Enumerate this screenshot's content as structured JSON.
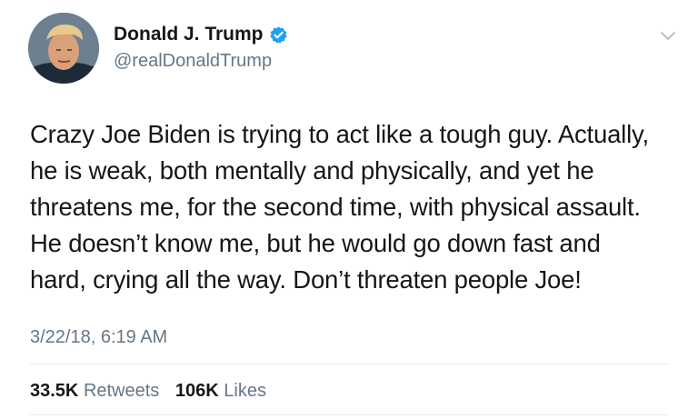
{
  "author": {
    "display_name": "Donald J. Trump",
    "handle": "@realDonaldTrump",
    "verified": true
  },
  "tweet": {
    "text_lines": [
      "Crazy Joe Biden is trying to act like a tough guy. Actually,",
      "he is weak, both mentally and physically, and yet he",
      "threatens me, for the second time, with physical assault.",
      "He doesn’t know me, but he would go down fast and",
      "hard, crying all the way. Don’t threaten people Joe!"
    ],
    "timestamp": "3/22/18, 6:19 AM"
  },
  "stats": {
    "retweets_count": "33.5K",
    "retweets_label": "Retweets",
    "likes_count": "106K",
    "likes_label": "Likes"
  },
  "colors": {
    "verified_badge": "#1da1f2",
    "secondary_text": "#657786",
    "primary_text": "#14171a",
    "divider": "#e6ecf0"
  },
  "icons": {
    "verified": "verified-badge-icon",
    "menu": "chevron-down-icon"
  }
}
